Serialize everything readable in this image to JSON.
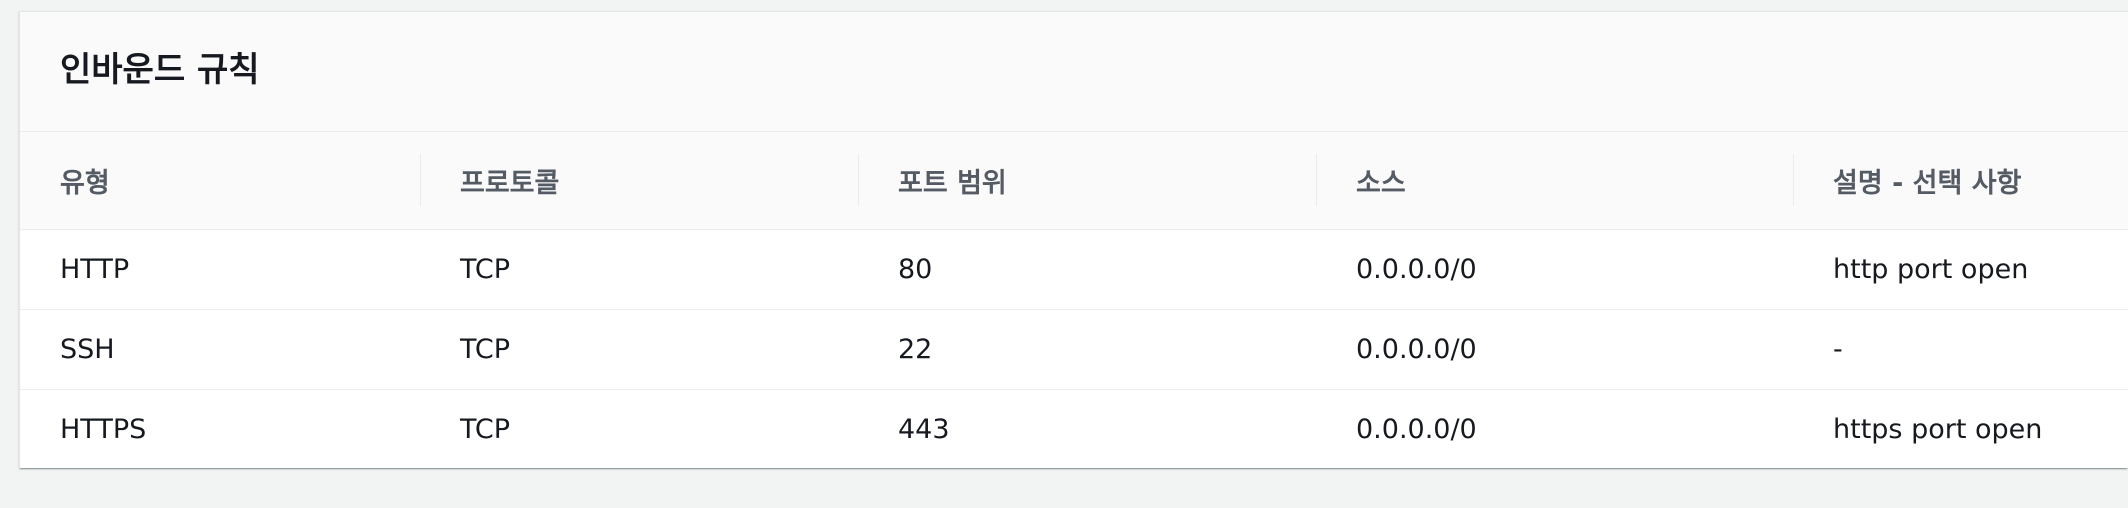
{
  "panel": {
    "title": "인바운드 규칙"
  },
  "table": {
    "columns": [
      "유형",
      "프로토콜",
      "포트 범위",
      "소스",
      "설명 - 선택 사항"
    ],
    "rows": [
      [
        "HTTP",
        "TCP",
        "80",
        "0.0.0.0/0",
        "http port open"
      ],
      [
        "SSH",
        "TCP",
        "22",
        "0.0.0.0/0",
        "-"
      ],
      [
        "HTTPS",
        "TCP",
        "443",
        "0.0.0.0/0",
        "https port open"
      ]
    ]
  },
  "colors": {
    "page_background": "#f2f3f3",
    "header_background": "#fafafa",
    "header_text": "#545b64",
    "body_text": "#16191f",
    "row_divider": "#eaeded"
  }
}
